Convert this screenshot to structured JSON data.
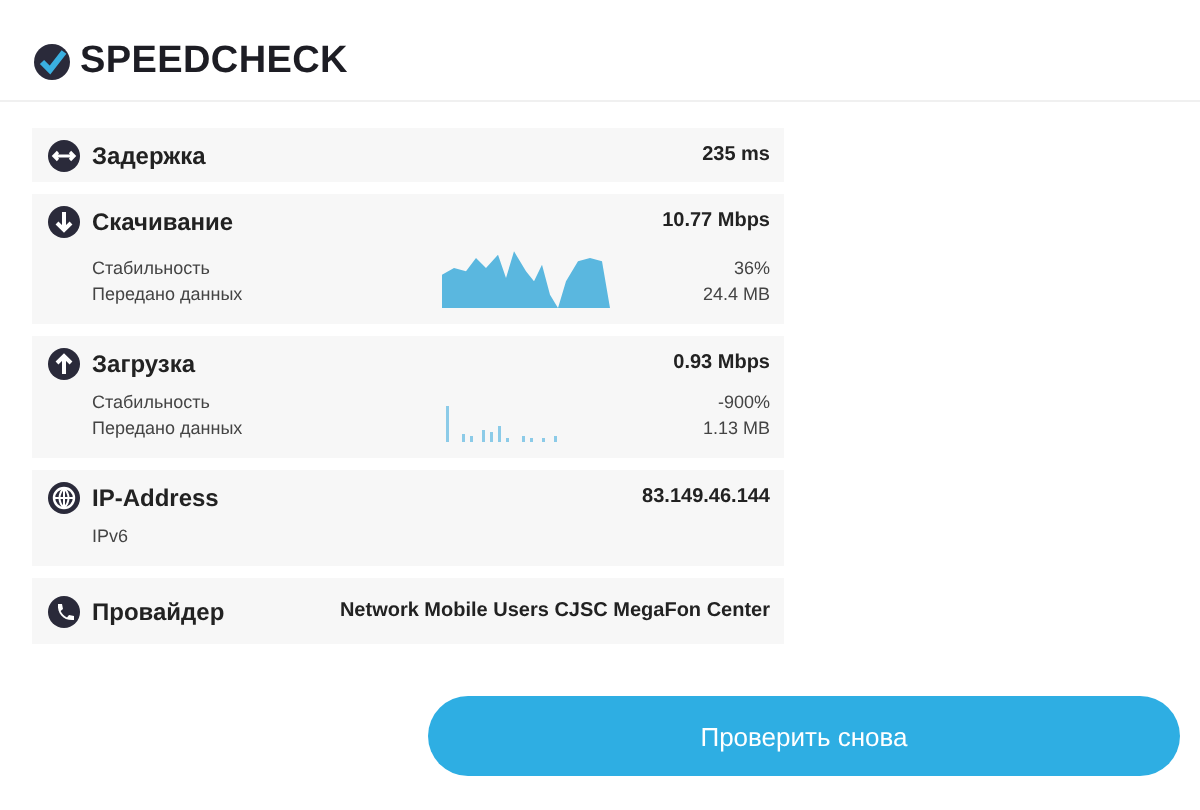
{
  "logo": {
    "text": "SPEEDCHECK"
  },
  "rows": [
    {
      "kind": "latency",
      "label": "Задержка",
      "value": "235 ms"
    },
    {
      "kind": "download",
      "label": "Скачивание",
      "value": "10.77 Mbps",
      "details": [
        {
          "label": "Стабильность",
          "value": "36%"
        },
        {
          "label": "Передано данных",
          "value": "24.4 MB"
        }
      ]
    },
    {
      "kind": "upload",
      "label": "Загрузка",
      "value": "0.93 Mbps",
      "details": [
        {
          "label": "Стабильность",
          "value": "-900%"
        },
        {
          "label": "Передано данных",
          "value": "1.13 MB"
        }
      ]
    },
    {
      "kind": "ip",
      "label": "IP-Address",
      "value": "83.149.46.144",
      "details": [
        {
          "label": "IPv6"
        }
      ]
    },
    {
      "kind": "provider",
      "label": "Провайдер",
      "value": "Network Mobile Users CJSC MegaFon Center"
    }
  ],
  "button": {
    "label": "Проверить снова"
  }
}
